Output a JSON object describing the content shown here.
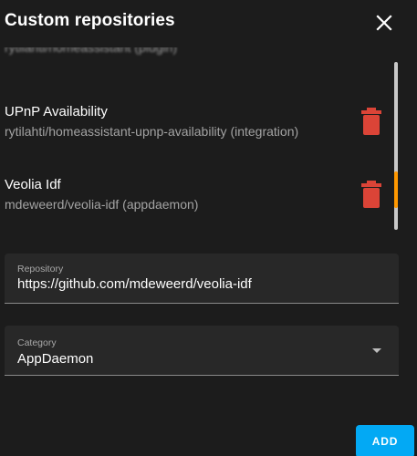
{
  "dialog": {
    "title": "Custom repositories"
  },
  "repositories": {
    "partial_item_text": "rytilahti/homeassistant (plugin)",
    "items": [
      {
        "name": "UPnP Availability",
        "path": "rytilahti/homeassistant-upnp-availability (integration)",
        "delete_icon": "trash-icon"
      },
      {
        "name": "Veolia Idf",
        "path": "mdeweerd/veolia-idf (appdaemon)",
        "delete_icon": "trash-icon"
      }
    ],
    "scroll_position_fraction": 0.83
  },
  "repository_field": {
    "label": "Repository",
    "value": "https://github.com/mdeweerd/veolia-idf"
  },
  "category_field": {
    "label": "Category",
    "selected": "AppDaemon"
  },
  "actions": {
    "add_label": "ADD"
  },
  "colors": {
    "background": "#1c1c1c",
    "delete_red": "#db4437",
    "primary_blue": "#03a9f4",
    "scroll_accent": "#ff9800"
  }
}
